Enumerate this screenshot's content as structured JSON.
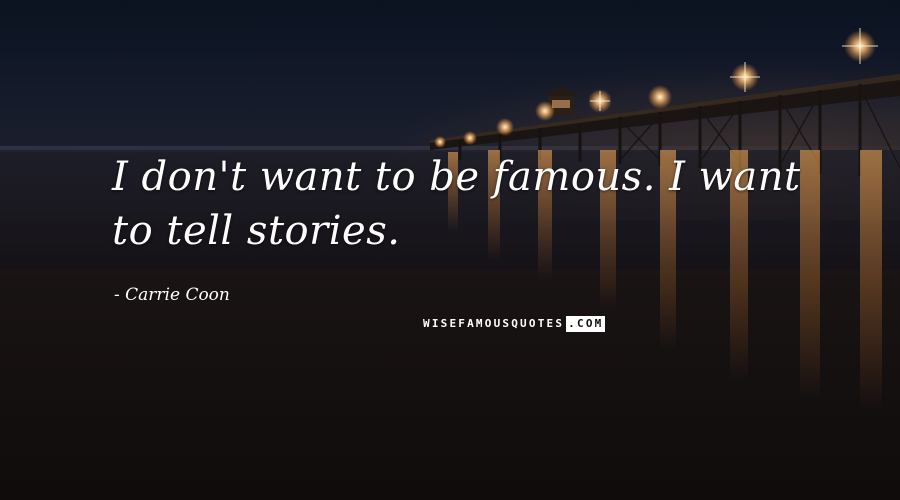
{
  "quote": {
    "text": "I don't want to be famous. I want to tell stories."
  },
  "author": {
    "text": "- Carrie Coon"
  },
  "watermark": {
    "part1": "WISEFAMOUSQUOTES",
    "part2": ".COM"
  },
  "scene": {
    "description_icons": [
      "pier-lights",
      "night-sea",
      "beach"
    ],
    "colors": {
      "sky": "#0b1220",
      "light": "#ffc27a",
      "text": "#ffffff"
    }
  }
}
